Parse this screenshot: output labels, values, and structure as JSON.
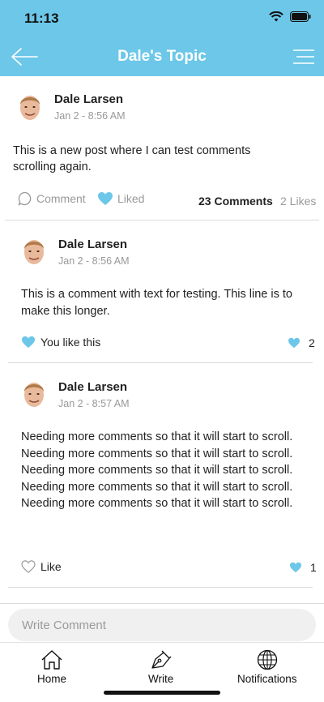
{
  "status_bar": {
    "time": "11:13"
  },
  "header": {
    "title": "Dale's Topic"
  },
  "post": {
    "author": "Dale Larsen",
    "time": "Jan 2 - 8:56 AM",
    "text": "This is a new post where I can test comments scrolling again.",
    "actions": {
      "comment_label": "Comment",
      "liked_label": "Liked"
    },
    "comments_count": "23 Comments",
    "likes_count": "2 Likes"
  },
  "comments": [
    {
      "author": "Dale Larsen",
      "time": "Jan 2 - 8:56 AM",
      "text": "This is a comment with text for testing. This line is to make this longer.",
      "like_label": "You like this",
      "like_count": "2"
    },
    {
      "author": "Dale Larsen",
      "time": "Jan 2 - 8:57 AM",
      "text": "Needing more comments so that it will start to scroll. Needing more comments so that it will start to scroll. Needing more comments so that it will start to scroll. Needing more comments so that it will start to scroll. Needing more comments so that it will start to scroll.",
      "like_label": "Like",
      "like_count": "1"
    }
  ],
  "composer": {
    "placeholder": "Write Comment"
  },
  "tabbar": {
    "home": "Home",
    "write": "Write",
    "notifications": "Notifications"
  },
  "colors": {
    "accent": "#6cc7e8",
    "heart": "#6cc7e8"
  },
  "icons": [
    "back-arrow-icon",
    "menu-icon",
    "comment-bubble-icon",
    "heart-icon",
    "home-icon",
    "pen-icon",
    "globe-icon"
  ]
}
